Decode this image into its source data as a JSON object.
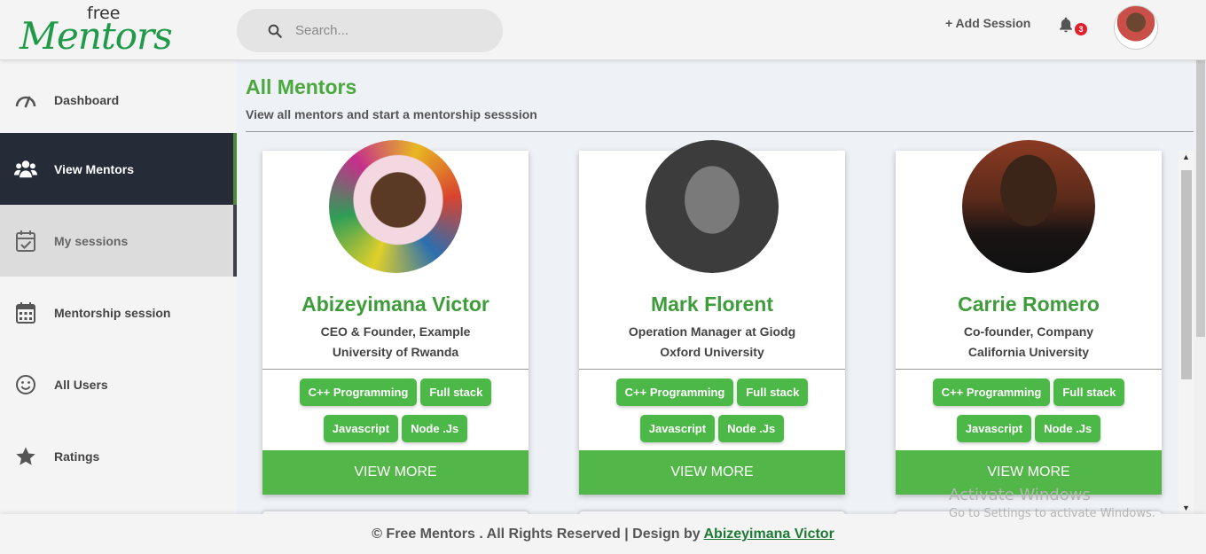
{
  "brand": {
    "small": "free",
    "big": "Mentors"
  },
  "search": {
    "placeholder": "Search..."
  },
  "header": {
    "add_session": "+ Add Session",
    "notifications_count": "3",
    "bell_icon": "bell-icon",
    "avatar_icon": "user-avatar"
  },
  "sidebar": {
    "items": [
      {
        "label": "Dashboard",
        "icon": "gauge-icon",
        "state": "normal"
      },
      {
        "label": "View Mentors",
        "icon": "users-icon",
        "state": "active"
      },
      {
        "label": "My sessions",
        "icon": "calendar-check-icon",
        "state": "hover"
      },
      {
        "label": "Mentorship session",
        "icon": "calendar-icon",
        "state": "normal"
      },
      {
        "label": "All Users",
        "icon": "smile-icon",
        "state": "normal"
      },
      {
        "label": "Ratings",
        "icon": "star-icon",
        "state": "normal"
      }
    ]
  },
  "main": {
    "title": "All Mentors",
    "subtitle": "View all mentors and start a mentorship sesssion"
  },
  "mentors": [
    {
      "name": "Abizeyimana Victor",
      "role": "CEO & Founder, Example",
      "school": "University of Rwanda",
      "tags": [
        "C++ Programming",
        "Full stack",
        "Javascript",
        "Node .Js"
      ],
      "action": "VIEW MORE"
    },
    {
      "name": "Mark Florent",
      "role": "Operation Manager at Giodg",
      "school": "Oxford University",
      "tags": [
        "C++ Programming",
        "Full stack",
        "Javascript",
        "Node .Js"
      ],
      "action": "VIEW MORE"
    },
    {
      "name": "Carrie Romero",
      "role": "Co-founder, Company",
      "school": "California University",
      "tags": [
        "C++ Programming",
        "Full stack",
        "Javascript",
        "Node .Js"
      ],
      "action": "VIEW MORE"
    }
  ],
  "footer": {
    "text": "© Free Mentors . All Rights Reserved | Design by",
    "link": "Abizeyimana Victor"
  },
  "watermark": {
    "line1": "Activate Windows",
    "line2": "Go to Settings to activate Windows."
  },
  "colors": {
    "accent": "#4cb847",
    "title_green": "#3f9c3a",
    "sidebar_active": "#252b37"
  }
}
